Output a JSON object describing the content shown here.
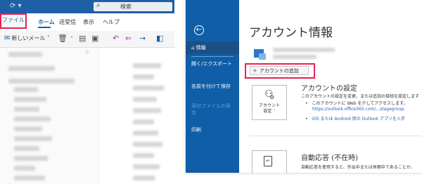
{
  "left_window": {
    "titlebar": {
      "search_placeholder": "検索"
    },
    "menu": {
      "file": "ファイル",
      "home": "ホーム",
      "send_receive": "送受信",
      "view": "表示",
      "help": "ヘルプ"
    },
    "ribbon": {
      "new_mail": "新しいメール"
    }
  },
  "backstage": {
    "nav": {
      "back_icon": "back-arrow-icon",
      "info": "情報",
      "open_export": "開く/エクスポート",
      "save_as": "名前を付けて保存",
      "save_attachments": "添付ファイルの保存",
      "print": "印刷"
    },
    "title": "アカウント情報",
    "add_account": "アカウントの追加",
    "account_settings": {
      "tile_label_1": "アカウント",
      "tile_label_2": "設定 ˅",
      "heading": "アカウントの設定",
      "description": "このアカウントの設定を変更、または追加の接続を設定します",
      "bullet1": "このアカウントに Web を介してアクセスします。",
      "bullet1_url": "https://outlook.office365.com/...stagegroup.",
      "bullet2": "iOS または Android 用の Outlook アプリを入手"
    },
    "auto_reply": {
      "heading": "自動応答 (不在時)",
      "description": "自動応答を使用すると、外出中または休暇中であることか、"
    }
  }
}
